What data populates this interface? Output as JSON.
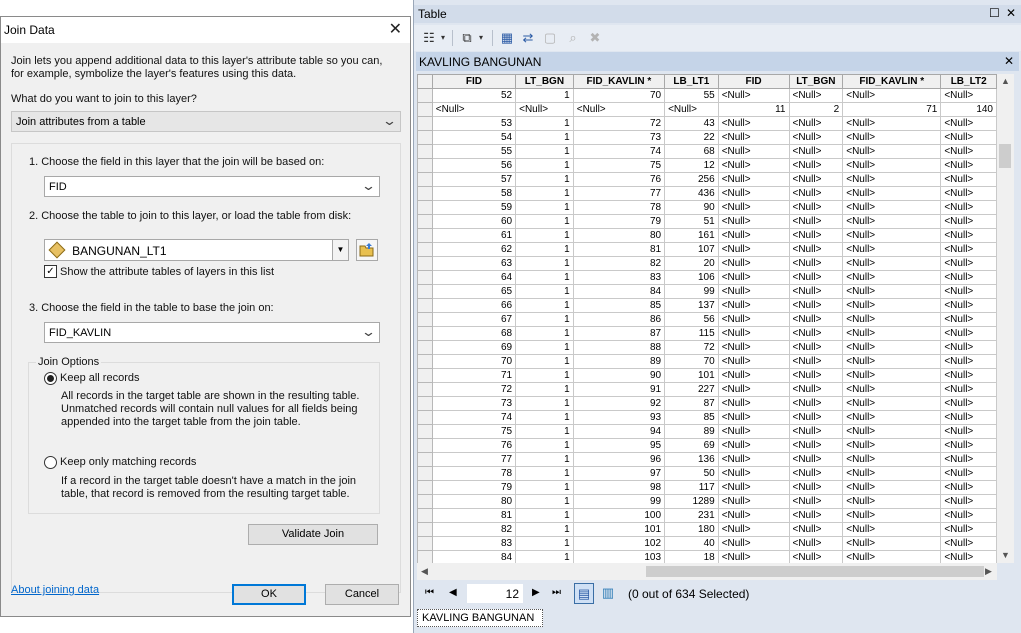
{
  "join_dialog": {
    "title": "Join Data",
    "intro_line1": "Join lets you append additional data to this layer's attribute table so you can,",
    "intro_line2": "for example, symbolize the layer's features using this data.",
    "what_prompt": "What do you want to join to this layer?",
    "join_type": "Join attributes from a table",
    "step1_label": "1.  Choose the field in this layer that the join will be based on:",
    "step1_value": "FID",
    "step2_label": "2.  Choose the table to join to this layer, or load the table from disk:",
    "step2_value": "BANGUNAN_LT1",
    "show_tables_label": "Show the attribute tables of layers in this list",
    "show_tables_checked": true,
    "step3_label": "3.  Choose the field in the table to base the join on:",
    "step3_value": "FID_KAVLIN",
    "options_label": "Join Options",
    "keep_all_label": "Keep all records",
    "keep_all_desc1": "All records in the target table are shown in the resulting table.",
    "keep_all_desc2": "Unmatched records will contain null values for all fields being",
    "keep_all_desc3": "appended into the target table from the join table.",
    "keep_match_label": "Keep only matching records",
    "keep_match_desc1": "If a record in the target table doesn't have a match in the join",
    "keep_match_desc2": "table, that record is removed from the resulting target table.",
    "selected_option": "keep_all",
    "validate_label": "Validate Join",
    "about_link": "About joining data",
    "ok_label": "OK",
    "cancel_label": "Cancel"
  },
  "table_window": {
    "title": "Table",
    "table_name": "KAVLING BANGUNAN",
    "columns": [
      "FID",
      "LT_BGN",
      "FID_KAVLIN *",
      "LB_LT1",
      "FID",
      "LT_BGN",
      "FID_KAVLIN *",
      "LB_LT2"
    ],
    "rows": [
      [
        "52",
        "1",
        "70",
        "55",
        "<Null>",
        "<Null>",
        "<Null>",
        "<Null>"
      ],
      [
        "<Null>",
        "<Null>",
        "<Null>",
        "<Null>",
        "11",
        "2",
        "71",
        "140"
      ],
      [
        "53",
        "1",
        "72",
        "43",
        "<Null>",
        "<Null>",
        "<Null>",
        "<Null>"
      ],
      [
        "54",
        "1",
        "73",
        "22",
        "<Null>",
        "<Null>",
        "<Null>",
        "<Null>"
      ],
      [
        "55",
        "1",
        "74",
        "68",
        "<Null>",
        "<Null>",
        "<Null>",
        "<Null>"
      ],
      [
        "56",
        "1",
        "75",
        "12",
        "<Null>",
        "<Null>",
        "<Null>",
        "<Null>"
      ],
      [
        "57",
        "1",
        "76",
        "256",
        "<Null>",
        "<Null>",
        "<Null>",
        "<Null>"
      ],
      [
        "58",
        "1",
        "77",
        "436",
        "<Null>",
        "<Null>",
        "<Null>",
        "<Null>"
      ],
      [
        "59",
        "1",
        "78",
        "90",
        "<Null>",
        "<Null>",
        "<Null>",
        "<Null>"
      ],
      [
        "60",
        "1",
        "79",
        "51",
        "<Null>",
        "<Null>",
        "<Null>",
        "<Null>"
      ],
      [
        "61",
        "1",
        "80",
        "161",
        "<Null>",
        "<Null>",
        "<Null>",
        "<Null>"
      ],
      [
        "62",
        "1",
        "81",
        "107",
        "<Null>",
        "<Null>",
        "<Null>",
        "<Null>"
      ],
      [
        "63",
        "1",
        "82",
        "20",
        "<Null>",
        "<Null>",
        "<Null>",
        "<Null>"
      ],
      [
        "64",
        "1",
        "83",
        "106",
        "<Null>",
        "<Null>",
        "<Null>",
        "<Null>"
      ],
      [
        "65",
        "1",
        "84",
        "99",
        "<Null>",
        "<Null>",
        "<Null>",
        "<Null>"
      ],
      [
        "66",
        "1",
        "85",
        "137",
        "<Null>",
        "<Null>",
        "<Null>",
        "<Null>"
      ],
      [
        "67",
        "1",
        "86",
        "56",
        "<Null>",
        "<Null>",
        "<Null>",
        "<Null>"
      ],
      [
        "68",
        "1",
        "87",
        "115",
        "<Null>",
        "<Null>",
        "<Null>",
        "<Null>"
      ],
      [
        "69",
        "1",
        "88",
        "72",
        "<Null>",
        "<Null>",
        "<Null>",
        "<Null>"
      ],
      [
        "70",
        "1",
        "89",
        "70",
        "<Null>",
        "<Null>",
        "<Null>",
        "<Null>"
      ],
      [
        "71",
        "1",
        "90",
        "101",
        "<Null>",
        "<Null>",
        "<Null>",
        "<Null>"
      ],
      [
        "72",
        "1",
        "91",
        "227",
        "<Null>",
        "<Null>",
        "<Null>",
        "<Null>"
      ],
      [
        "73",
        "1",
        "92",
        "87",
        "<Null>",
        "<Null>",
        "<Null>",
        "<Null>"
      ],
      [
        "74",
        "1",
        "93",
        "85",
        "<Null>",
        "<Null>",
        "<Null>",
        "<Null>"
      ],
      [
        "75",
        "1",
        "94",
        "89",
        "<Null>",
        "<Null>",
        "<Null>",
        "<Null>"
      ],
      [
        "76",
        "1",
        "95",
        "69",
        "<Null>",
        "<Null>",
        "<Null>",
        "<Null>"
      ],
      [
        "77",
        "1",
        "96",
        "136",
        "<Null>",
        "<Null>",
        "<Null>",
        "<Null>"
      ],
      [
        "78",
        "1",
        "97",
        "50",
        "<Null>",
        "<Null>",
        "<Null>",
        "<Null>"
      ],
      [
        "79",
        "1",
        "98",
        "117",
        "<Null>",
        "<Null>",
        "<Null>",
        "<Null>"
      ],
      [
        "80",
        "1",
        "99",
        "1289",
        "<Null>",
        "<Null>",
        "<Null>",
        "<Null>"
      ],
      [
        "81",
        "1",
        "100",
        "231",
        "<Null>",
        "<Null>",
        "<Null>",
        "<Null>"
      ],
      [
        "82",
        "1",
        "101",
        "180",
        "<Null>",
        "<Null>",
        "<Null>",
        "<Null>"
      ],
      [
        "83",
        "1",
        "102",
        "40",
        "<Null>",
        "<Null>",
        "<Null>",
        "<Null>"
      ],
      [
        "84",
        "1",
        "103",
        "18",
        "<Null>",
        "<Null>",
        "<Null>",
        "<Null>"
      ]
    ],
    "current_record": "12",
    "selection_status": "(0 out of 634 Selected)",
    "bottom_tab": "KAVLING BANGUNAN"
  },
  "icons": [
    "close-icon",
    "chevron-down-icon",
    "layer-table-icon",
    "folder-open-icon",
    "restore-icon",
    "table-options-icon",
    "related-tables-icon",
    "select-by-attributes-icon",
    "switch-selection-icon",
    "clear-selection-icon",
    "zoom-selected-icon",
    "delete-selected-icon",
    "first-record-icon",
    "previous-record-icon",
    "next-record-icon",
    "last-record-icon",
    "show-all-records-icon",
    "show-selected-records-icon"
  ]
}
